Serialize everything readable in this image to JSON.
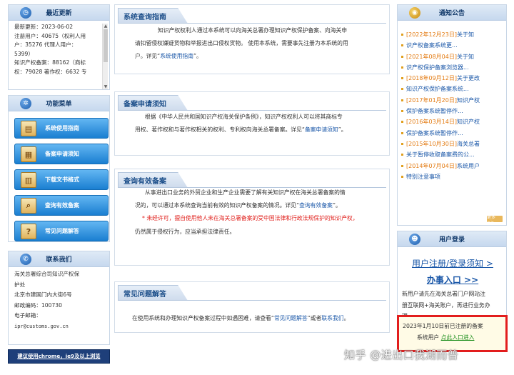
{
  "left": {
    "latest": {
      "title": "最近更新",
      "lines": [
        "最新更新：2023-06-02",
        "注册用户：40675（权利人用",
        "户：35276  代理人用户：",
        "5399）",
        "知识产权备案：88162（商标",
        "权：79028  著作权：6632  专"
      ]
    },
    "menu": {
      "title": "功能菜单",
      "items": [
        "系统使用指南",
        "备案申请须知",
        "下载文书格式",
        "查询有效备案",
        "常见问题解答"
      ]
    },
    "contact": {
      "title": "联系我们",
      "lines": [
        "海关总署综合司知识产权保",
        "护处",
        "北京市建国门内大街6号",
        "邮政编码：100730",
        "电子邮箱：",
        "ipr@customs.gov.cn"
      ]
    },
    "browser_notice": "建议使用chrome，ie9及以上浏览"
  },
  "main": {
    "guide": {
      "tab": "系统查询指南",
      "p1": "知识产权权利人通过本系统可以向海关总署办理知识产权保护备案、向海关申",
      "p2": "请扣留侵权嫌疑货物和举报进出口侵权货物。 使用本系统，需要事先注册为本系统的用",
      "p3a": "户。详见“",
      "p3link": "系统使用指南",
      "p3b": "”。"
    },
    "apply": {
      "tab": "备案申请须知",
      "p1": "根据《中华人民共和国知识产权海关保护条例》，知识产权权利人可以将其商标专",
      "p2a": "用权、著作权和与著作权相关的权利、专利权向海关总署备案。详见“",
      "p2link": "备案申请须知",
      "p2b": "”。"
    },
    "query": {
      "tab": "查询有效备案",
      "p1": "从事进出口业务的外贸企业和生产企业需要了解有关知识产权在海关总署备案的情",
      "p2a": "况的，可以通过本系统查询当前有效的知识产权备案的情况。详见“",
      "p2link": "查询有效备案",
      "p2b": "”。",
      "warn": "* 未经许可，擅自使用他人未在海关总署备案的受中国法律和行政法规保护的知识产权，",
      "p4": "仍然属于侵权行为，应当承担法律责任。"
    },
    "faq": {
      "tab": "常见问题解答",
      "p1a": "在使用系统和办理知识产权备案过程中如遇困难，请查看“",
      "p1link": "常见问题解答",
      "p1b": "”或者",
      "p1link2": "联系我们",
      "p1c": "。"
    }
  },
  "right": {
    "notice": {
      "title": "通知公告",
      "items": [
        [
          "[2022年12月23日]",
          "关于知"
        ],
        [
          "",
          "识产权备案系统更..."
        ],
        [
          "[2021年08月04日]",
          "关于知"
        ],
        [
          "",
          "识产权保护备案浏览器..."
        ],
        [
          "[2018年09月12日]",
          "关于更改"
        ],
        [
          "",
          "知识产权保护备案系统..."
        ],
        [
          "[2017年01月20日]",
          "知识产权"
        ],
        [
          "",
          "保护备案系统暂停作..."
        ],
        [
          "[2016年03月14日]",
          "知识产权"
        ],
        [
          "",
          "保护备案系统暂停作..."
        ],
        [
          "[2015年10月30日]",
          "海关总署"
        ],
        [
          "",
          "关于暂停收取备案费的公..."
        ],
        [
          "[2014年07月04日]",
          "系统用户"
        ],
        [
          "",
          "特别注意事项"
        ]
      ],
      "more": "更多>>"
    },
    "login": {
      "title": "用户登录",
      "register": "用户注册/登录须知 >",
      "enter": "办事入口 >>",
      "l1": "新用户请先在海关总署门户网站注",
      "l2": "册互联网+海关账户，再进行业务办",
      "l3": "理",
      "r1": "2023年1月10日前已注册的备案",
      "r2a": "系统用户  ",
      "r2link": "点此入口进入"
    }
  },
  "watermark": "知乎 @进出口我湖而普"
}
